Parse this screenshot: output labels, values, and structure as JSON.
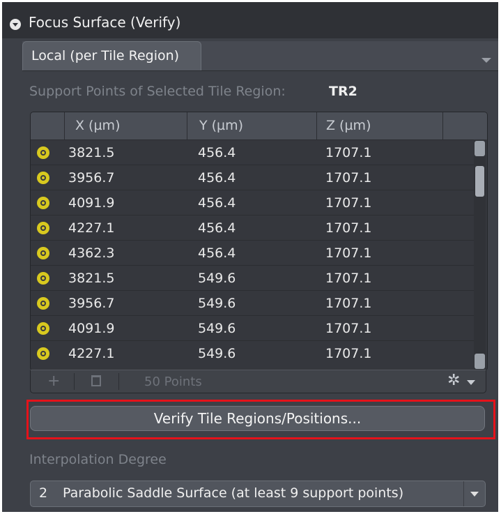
{
  "section": {
    "title": "Focus Surface (Verify)",
    "icon": "collapse-circle-icon"
  },
  "tabs": [
    {
      "label": "Local (per Tile Region)",
      "active": true
    }
  ],
  "support": {
    "label": "Support Points of Selected Tile Region:",
    "value": "TR2"
  },
  "table": {
    "columns": [
      "X (µm)",
      "Y (µm)",
      "Z (µm)"
    ],
    "rows": [
      {
        "x": "3821.5",
        "y": "456.4",
        "z": "1707.1"
      },
      {
        "x": "3956.7",
        "y": "456.4",
        "z": "1707.1"
      },
      {
        "x": "4091.9",
        "y": "456.4",
        "z": "1707.1"
      },
      {
        "x": "4227.1",
        "y": "456.4",
        "z": "1707.1"
      },
      {
        "x": "4362.3",
        "y": "456.4",
        "z": "1707.1"
      },
      {
        "x": "3821.5",
        "y": "549.6",
        "z": "1707.1"
      },
      {
        "x": "3956.7",
        "y": "549.6",
        "z": "1707.1"
      },
      {
        "x": "4091.9",
        "y": "549.6",
        "z": "1707.1"
      },
      {
        "x": "4227.1",
        "y": "549.6",
        "z": "1707.1"
      }
    ],
    "footer": {
      "add": "+",
      "count": "50 Points",
      "settings": "✲"
    }
  },
  "verify_button": {
    "label": "Verify Tile Regions/Positions..."
  },
  "interpolation": {
    "label": "Interpolation Degree",
    "selected_number": "2",
    "selected_label": "Parabolic Saddle Surface (at least 9 support points)"
  },
  "colors": {
    "highlight": "#e5121a",
    "point_icon": "#d8c91f",
    "panel": "#3d4047"
  }
}
